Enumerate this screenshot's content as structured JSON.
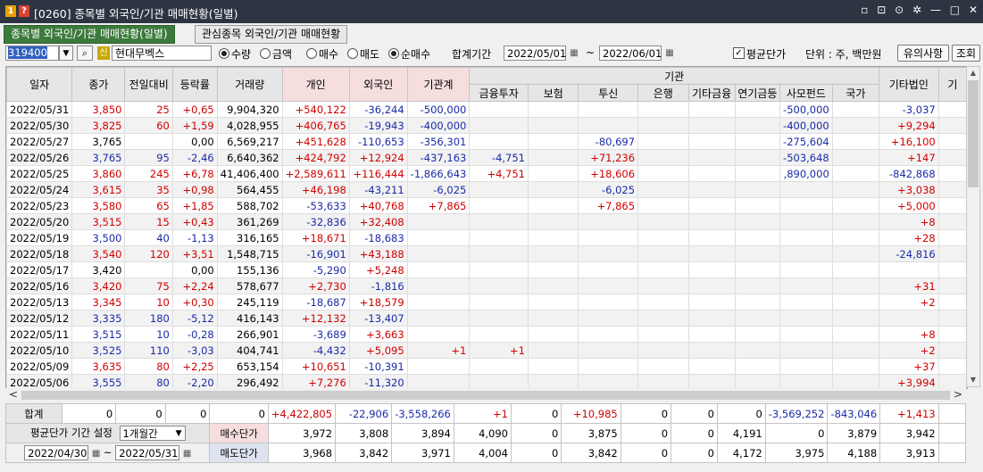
{
  "window": {
    "badge1": "1",
    "badge2": "?",
    "title": "[0260] 종목별 외국인/기관 매매현황(일별)",
    "controls": [
      "▫",
      "⊡",
      "⊙",
      "✲",
      "—",
      "□",
      "✕"
    ]
  },
  "tabs": [
    {
      "label": "종목별 외국인/기관 매매현황(일별)",
      "active": true
    },
    {
      "label": "관심종목 외국인/기관 매매현황",
      "active": false
    }
  ],
  "toolbar": {
    "code": "319400",
    "credit_badge": "신",
    "stock_name": "현대무벡스",
    "mode_options": [
      {
        "label": "수량",
        "on": true
      },
      {
        "label": "금액",
        "on": false
      }
    ],
    "trade_options": [
      {
        "label": "매수",
        "on": false
      },
      {
        "label": "매도",
        "on": false
      },
      {
        "label": "순매수",
        "on": true
      }
    ],
    "period_label": "합계기간",
    "date_from": "2022/05/01",
    "tilde": "~",
    "date_to": "2022/06/01",
    "avg_price_label": "평균단가",
    "avg_price_checked": true,
    "unit_text": "단위 : 주, 백만원",
    "notice_button": "유의사항",
    "query_button": "조회"
  },
  "table": {
    "headers": {
      "date": "일자",
      "close": "종가",
      "change": "전일대비",
      "rate": "등락률",
      "volume": "거래량",
      "individual": "개인",
      "foreign": "외국인",
      "inst_total": "기관계",
      "inst_group": "기관",
      "financial": "금융투자",
      "insurance": "보험",
      "trust": "투신",
      "bank": "은행",
      "other_fin": "기타금융",
      "pension": "연기금등",
      "private_fund": "사모펀드",
      "nation": "국가",
      "other_corp": "기타법인",
      "more": "기"
    },
    "rows": [
      {
        "date": "2022/05/31",
        "close": "3,850",
        "change": "25",
        "rate": "+0,65",
        "volume": "9,904,320",
        "individual": "+540,122",
        "foreign": "-36,244",
        "inst_total": "-500,000",
        "financial": "",
        "insurance": "",
        "trust": "",
        "bank": "",
        "other_fin": "",
        "pension": "",
        "private_fund": "-500,000",
        "nation": "",
        "other_corp": "-3,037",
        "dir": "up"
      },
      {
        "date": "2022/05/30",
        "close": "3,825",
        "change": "60",
        "rate": "+1,59",
        "volume": "4,028,955",
        "individual": "+406,765",
        "foreign": "-19,943",
        "inst_total": "-400,000",
        "financial": "",
        "insurance": "",
        "trust": "",
        "bank": "",
        "other_fin": "",
        "pension": "",
        "private_fund": "-400,000",
        "nation": "",
        "other_corp": "+9,294",
        "dir": "up"
      },
      {
        "date": "2022/05/27",
        "close": "3,765",
        "change": "",
        "rate": "0,00",
        "volume": "6,569,217",
        "individual": "+451,628",
        "foreign": "-110,653",
        "inst_total": "-356,301",
        "financial": "",
        "insurance": "",
        "trust": "-80,697",
        "bank": "",
        "other_fin": "",
        "pension": "",
        "private_fund": "-275,604",
        "nation": "",
        "other_corp": "+16,100",
        "dir": "flat"
      },
      {
        "date": "2022/05/26",
        "close": "3,765",
        "change": "95",
        "rate": "-2,46",
        "volume": "6,640,362",
        "individual": "+424,792",
        "foreign": "+12,924",
        "inst_total": "-437,163",
        "financial": "-4,751",
        "insurance": "",
        "trust": "+71,236",
        "bank": "",
        "other_fin": "",
        "pension": "",
        "private_fund": "-503,648",
        "nation": "",
        "other_corp": "+147",
        "dir": "down"
      },
      {
        "date": "2022/05/25",
        "close": "3,860",
        "change": "245",
        "rate": "+6,78",
        "volume": "41,406,400",
        "individual": "+2,589,611",
        "foreign": "+116,444",
        "inst_total": "-1,866,643",
        "financial": "+4,751",
        "insurance": "",
        "trust": "+18,606",
        "bank": "",
        "other_fin": "",
        "pension": "",
        "private_fund": ",890,000",
        "nation": "",
        "other_corp": "-842,868",
        "dir": "up"
      },
      {
        "date": "2022/05/24",
        "close": "3,615",
        "change": "35",
        "rate": "+0,98",
        "volume": "564,455",
        "individual": "+46,198",
        "foreign": "-43,211",
        "inst_total": "-6,025",
        "financial": "",
        "insurance": "",
        "trust": "-6,025",
        "bank": "",
        "other_fin": "",
        "pension": "",
        "private_fund": "",
        "nation": "",
        "other_corp": "+3,038",
        "dir": "up"
      },
      {
        "date": "2022/05/23",
        "close": "3,580",
        "change": "65",
        "rate": "+1,85",
        "volume": "588,702",
        "individual": "-53,633",
        "foreign": "+40,768",
        "inst_total": "+7,865",
        "financial": "",
        "insurance": "",
        "trust": "+7,865",
        "bank": "",
        "other_fin": "",
        "pension": "",
        "private_fund": "",
        "nation": "",
        "other_corp": "+5,000",
        "dir": "up"
      },
      {
        "date": "2022/05/20",
        "close": "3,515",
        "change": "15",
        "rate": "+0,43",
        "volume": "361,269",
        "individual": "-32,836",
        "foreign": "+32,408",
        "inst_total": "",
        "financial": "",
        "insurance": "",
        "trust": "",
        "bank": "",
        "other_fin": "",
        "pension": "",
        "private_fund": "",
        "nation": "",
        "other_corp": "+8",
        "dir": "up"
      },
      {
        "date": "2022/05/19",
        "close": "3,500",
        "change": "40",
        "rate": "-1,13",
        "volume": "316,165",
        "individual": "+18,671",
        "foreign": "-18,683",
        "inst_total": "",
        "financial": "",
        "insurance": "",
        "trust": "",
        "bank": "",
        "other_fin": "",
        "pension": "",
        "private_fund": "",
        "nation": "",
        "other_corp": "+28",
        "dir": "down"
      },
      {
        "date": "2022/05/18",
        "close": "3,540",
        "change": "120",
        "rate": "+3,51",
        "volume": "1,548,715",
        "individual": "-16,901",
        "foreign": "+43,188",
        "inst_total": "",
        "financial": "",
        "insurance": "",
        "trust": "",
        "bank": "",
        "other_fin": "",
        "pension": "",
        "private_fund": "",
        "nation": "",
        "other_corp": "-24,816",
        "dir": "up"
      },
      {
        "date": "2022/05/17",
        "close": "3,420",
        "change": "",
        "rate": "0,00",
        "volume": "155,136",
        "individual": "-5,290",
        "foreign": "+5,248",
        "inst_total": "",
        "financial": "",
        "insurance": "",
        "trust": "",
        "bank": "",
        "other_fin": "",
        "pension": "",
        "private_fund": "",
        "nation": "",
        "other_corp": "",
        "dir": "flat"
      },
      {
        "date": "2022/05/16",
        "close": "3,420",
        "change": "75",
        "rate": "+2,24",
        "volume": "578,677",
        "individual": "+2,730",
        "foreign": "-1,816",
        "inst_total": "",
        "financial": "",
        "insurance": "",
        "trust": "",
        "bank": "",
        "other_fin": "",
        "pension": "",
        "private_fund": "",
        "nation": "",
        "other_corp": "+31",
        "dir": "up"
      },
      {
        "date": "2022/05/13",
        "close": "3,345",
        "change": "10",
        "rate": "+0,30",
        "volume": "245,119",
        "individual": "-18,687",
        "foreign": "+18,579",
        "inst_total": "",
        "financial": "",
        "insurance": "",
        "trust": "",
        "bank": "",
        "other_fin": "",
        "pension": "",
        "private_fund": "",
        "nation": "",
        "other_corp": "+2",
        "dir": "up"
      },
      {
        "date": "2022/05/12",
        "close": "3,335",
        "change": "180",
        "rate": "-5,12",
        "volume": "416,143",
        "individual": "+12,132",
        "foreign": "-13,407",
        "inst_total": "",
        "financial": "",
        "insurance": "",
        "trust": "",
        "bank": "",
        "other_fin": "",
        "pension": "",
        "private_fund": "",
        "nation": "",
        "other_corp": "",
        "dir": "down"
      },
      {
        "date": "2022/05/11",
        "close": "3,515",
        "change": "10",
        "rate": "-0,28",
        "volume": "266,901",
        "individual": "-3,689",
        "foreign": "+3,663",
        "inst_total": "",
        "financial": "",
        "insurance": "",
        "trust": "",
        "bank": "",
        "other_fin": "",
        "pension": "",
        "private_fund": "",
        "nation": "",
        "other_corp": "+8",
        "dir": "down"
      },
      {
        "date": "2022/05/10",
        "close": "3,525",
        "change": "110",
        "rate": "-3,03",
        "volume": "404,741",
        "individual": "-4,432",
        "foreign": "+5,095",
        "inst_total": "+1",
        "financial": "+1",
        "insurance": "",
        "trust": "",
        "bank": "",
        "other_fin": "",
        "pension": "",
        "private_fund": "",
        "nation": "",
        "other_corp": "+2",
        "dir": "down"
      },
      {
        "date": "2022/05/09",
        "close": "3,635",
        "change": "80",
        "rate": "+2,25",
        "volume": "653,154",
        "individual": "+10,651",
        "foreign": "-10,391",
        "inst_total": "",
        "financial": "",
        "insurance": "",
        "trust": "",
        "bank": "",
        "other_fin": "",
        "pension": "",
        "private_fund": "",
        "nation": "",
        "other_corp": "+37",
        "dir": "up"
      },
      {
        "date": "2022/05/06",
        "close": "3,555",
        "change": "80",
        "rate": "-2,20",
        "volume": "296,492",
        "individual": "+7,276",
        "foreign": "-11,320",
        "inst_total": "",
        "financial": "",
        "insurance": "",
        "trust": "",
        "bank": "",
        "other_fin": "",
        "pension": "",
        "private_fund": "",
        "nation": "",
        "other_corp": "+3,994",
        "dir": "down"
      }
    ]
  },
  "scroll": {
    "left": "<",
    "right": ">",
    "up": "▲",
    "down": "▼"
  },
  "totals": {
    "label": "합계",
    "values": [
      "0",
      "0",
      "0",
      "0",
      "+4,422,805",
      "-22,906",
      "-3,558,266",
      "+1",
      "0",
      "+10,985",
      "0",
      "0",
      "0",
      "-3,569,252",
      "-843,046",
      "+1,413"
    ],
    "avg_setting_label": "평균단가 기간 설정",
    "avg_period": "1개월간",
    "buy_label": "매수단가",
    "buy_values": [
      "3,972",
      "3,808",
      "3,894",
      "4,090",
      "0",
      "3,875",
      "0",
      "0",
      "4,191",
      "0",
      "3,879",
      "3,942"
    ],
    "sell_label": "매도단가",
    "sell_values": [
      "3,968",
      "3,842",
      "3,971",
      "4,004",
      "0",
      "3,842",
      "0",
      "0",
      "4,172",
      "3,975",
      "4,188",
      "3,913"
    ],
    "period_from": "2022/04/30",
    "period_tilde": "~",
    "period_to": "2022/05/31"
  },
  "colors": {
    "up": "#d00000",
    "down": "#1a2aa8",
    "tab_active": "#3c7a3c",
    "titlebar": "#2d3542"
  }
}
